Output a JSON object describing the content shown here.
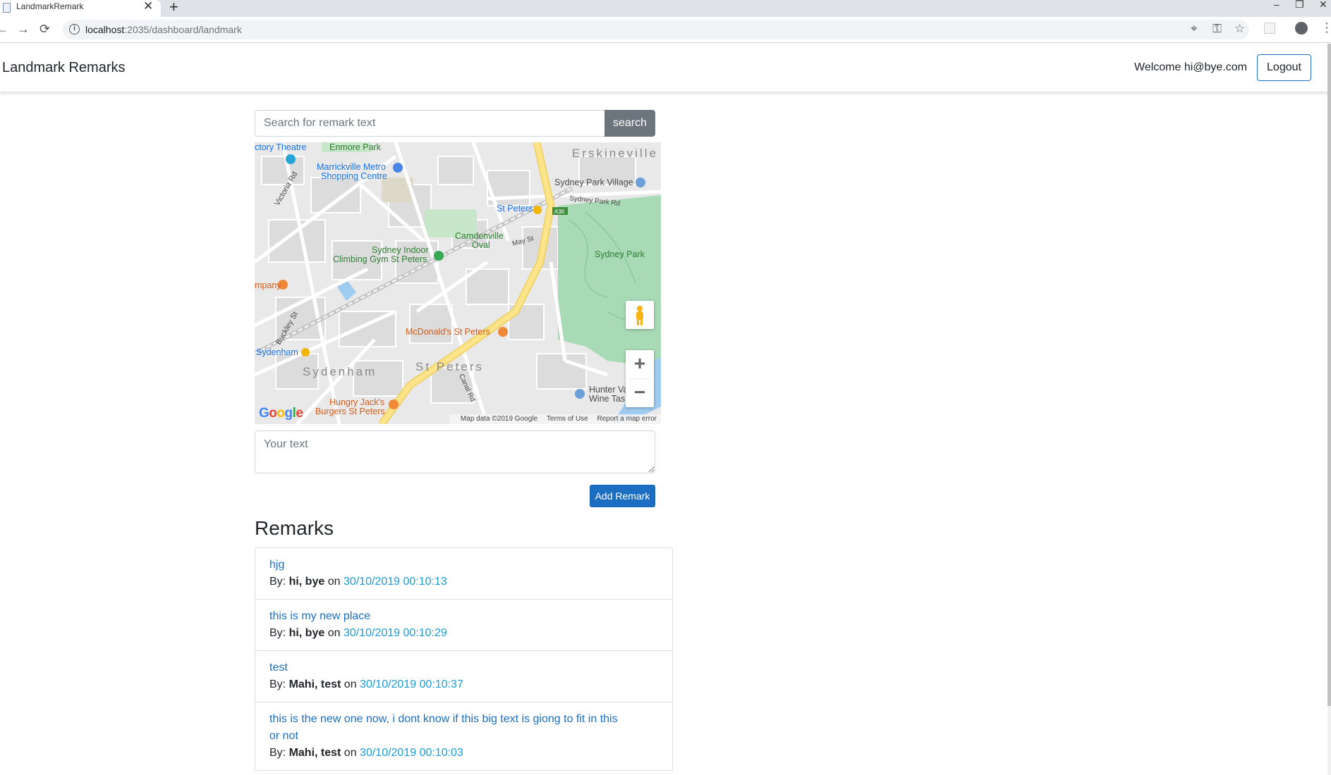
{
  "browser": {
    "tab_title": "LandmarkRemark",
    "tab_close": "✕",
    "new_tab": "+",
    "url_host": "localhost",
    "url_rest": ":2035/dashboard/landmark",
    "window_controls": [
      "–",
      "❐",
      "✕"
    ]
  },
  "navbar": {
    "brand": "Landmark Remarks",
    "welcome": "Welcome hi@bye.com",
    "logout_label": "Logout"
  },
  "search": {
    "placeholder": "Search for remark text",
    "button_label": "search"
  },
  "map": {
    "labels": [
      {
        "text": "ctory Theatre",
        "style": "ml-blue"
      },
      {
        "text": "Enmore Park",
        "style": "ml-green"
      },
      {
        "text": "Marrickville Metro",
        "style": "ml-blue"
      },
      {
        "text": "Shopping Centre",
        "style": "ml-blue"
      },
      {
        "text": "Erskineville",
        "style": "ml-area"
      },
      {
        "text": "Sydney Park Village",
        "style": "ml-dark"
      },
      {
        "text": "St Peters",
        "style": "ml-blue"
      },
      {
        "text": "Sydney Park Rd",
        "style": "ml-dark"
      },
      {
        "text": "Camdenville",
        "style": "ml-green"
      },
      {
        "text": "Oval",
        "style": "ml-green"
      },
      {
        "text": "Sydney Indoor",
        "style": "ml-green"
      },
      {
        "text": "Climbing Gym St Peters",
        "style": "ml-green"
      },
      {
        "text": "Sydney Park",
        "style": "ml-green"
      },
      {
        "text": "McDonald's St Peters",
        "style": "ml-orange"
      },
      {
        "text": "Sydenham",
        "style": "ml-blue"
      },
      {
        "text": "Sydenham",
        "style": "ml-area"
      },
      {
        "text": "St Peters",
        "style": "ml-area"
      },
      {
        "text": "Hungry Jack's",
        "style": "ml-orange"
      },
      {
        "text": "Burgers St Peters",
        "style": "ml-orange"
      },
      {
        "text": "Hunter Va",
        "style": "ml-dark"
      },
      {
        "text": "Wine Tas",
        "style": "ml-dark"
      },
      {
        "text": "Victoria Rd",
        "style": "ml-dark"
      },
      {
        "text": "Buckley St",
        "style": "ml-dark"
      },
      {
        "text": "May St",
        "style": "ml-dark"
      },
      {
        "text": "Canal Rd",
        "style": "ml-dark"
      },
      {
        "text": "mpany",
        "style": "ml-orange"
      }
    ],
    "zoom_in": "+",
    "zoom_out": "−",
    "google_logo": "Google",
    "footer": {
      "map_data": "Map data ©2019 Google",
      "terms": "Terms of Use",
      "report": "Report a map error"
    }
  },
  "remark_input": {
    "placeholder": "Your text"
  },
  "add_button_label": "Add Remark",
  "remarks_title": "Remarks",
  "remarks": [
    {
      "text": "hjg",
      "by_prefix": "By: ",
      "author": "hi, bye",
      "on": " on ",
      "date": "30/10/2019 00:10:13"
    },
    {
      "text": "this is my new place",
      "by_prefix": "By: ",
      "author": "hi, bye",
      "on": " on ",
      "date": "30/10/2019 00:10:29"
    },
    {
      "text": "test",
      "by_prefix": "By: ",
      "author": "Mahi, test",
      "on": " on ",
      "date": "30/10/2019 00:10:37"
    },
    {
      "text": "this is the new one now, i dont know if this big text is giong to fit in this or not",
      "by_prefix": "By: ",
      "author": "Mahi, test",
      "on": " on ",
      "date": "30/10/2019 00:10:03"
    }
  ],
  "colors": {
    "primary": "#1b6ec2",
    "secondary": "#6c757d",
    "park_green": "#a8dab5",
    "main_road": "#fbe48a"
  }
}
